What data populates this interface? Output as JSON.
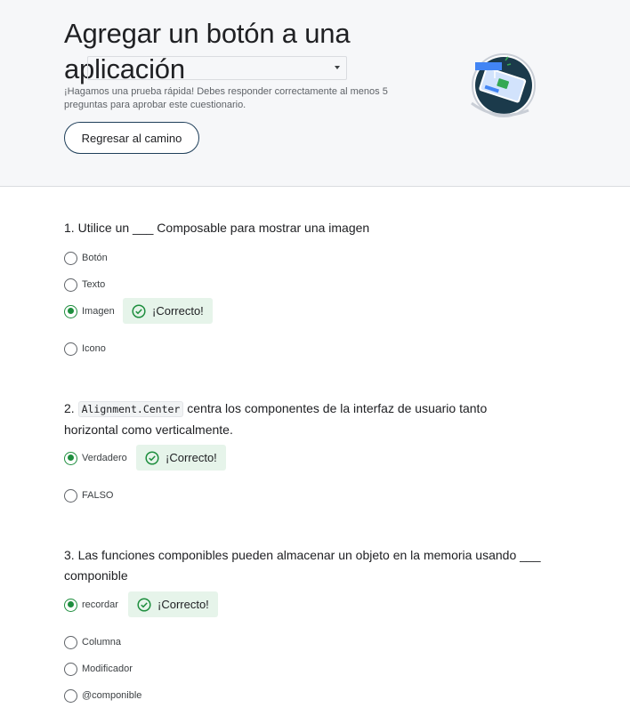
{
  "header": {
    "title": "Agregar un botón a una aplicación",
    "description": "¡Hagamos una prueba rápida! Debes responder correctamente al menos 5 preguntas para aprobar este cuestionario.",
    "back_button": "Regresar al camino",
    "language_select_value": ""
  },
  "feedback_label": "¡Correcto!",
  "colors": {
    "correct": "#1e8e3e",
    "correct_bg": "#e6f4ea",
    "button_border": "#1f3f5a"
  },
  "questions": [
    {
      "number": "1.",
      "text": "Utilice un ___ Composable para mostrar una imagen",
      "options": [
        "Botón",
        "Texto",
        "Imagen",
        "Icono"
      ],
      "selected": "Imagen",
      "result": "¡Correcto!"
    },
    {
      "number": "2.",
      "code": "Alignment.Center",
      "text": "centra los componentes de la interfaz de usuario tanto horizontal como verticalmente.",
      "options": [
        "Verdadero",
        "FALSO"
      ],
      "selected": "Verdadero",
      "result": "¡Correcto!"
    },
    {
      "number": "3.",
      "text": "Las funciones componibles pueden almacenar un objeto en la memoria usando ___ componible",
      "options": [
        "recordar",
        "Columna",
        "Modificador",
        "@componible"
      ],
      "selected": "recordar",
      "result": "¡Correcto!"
    }
  ]
}
